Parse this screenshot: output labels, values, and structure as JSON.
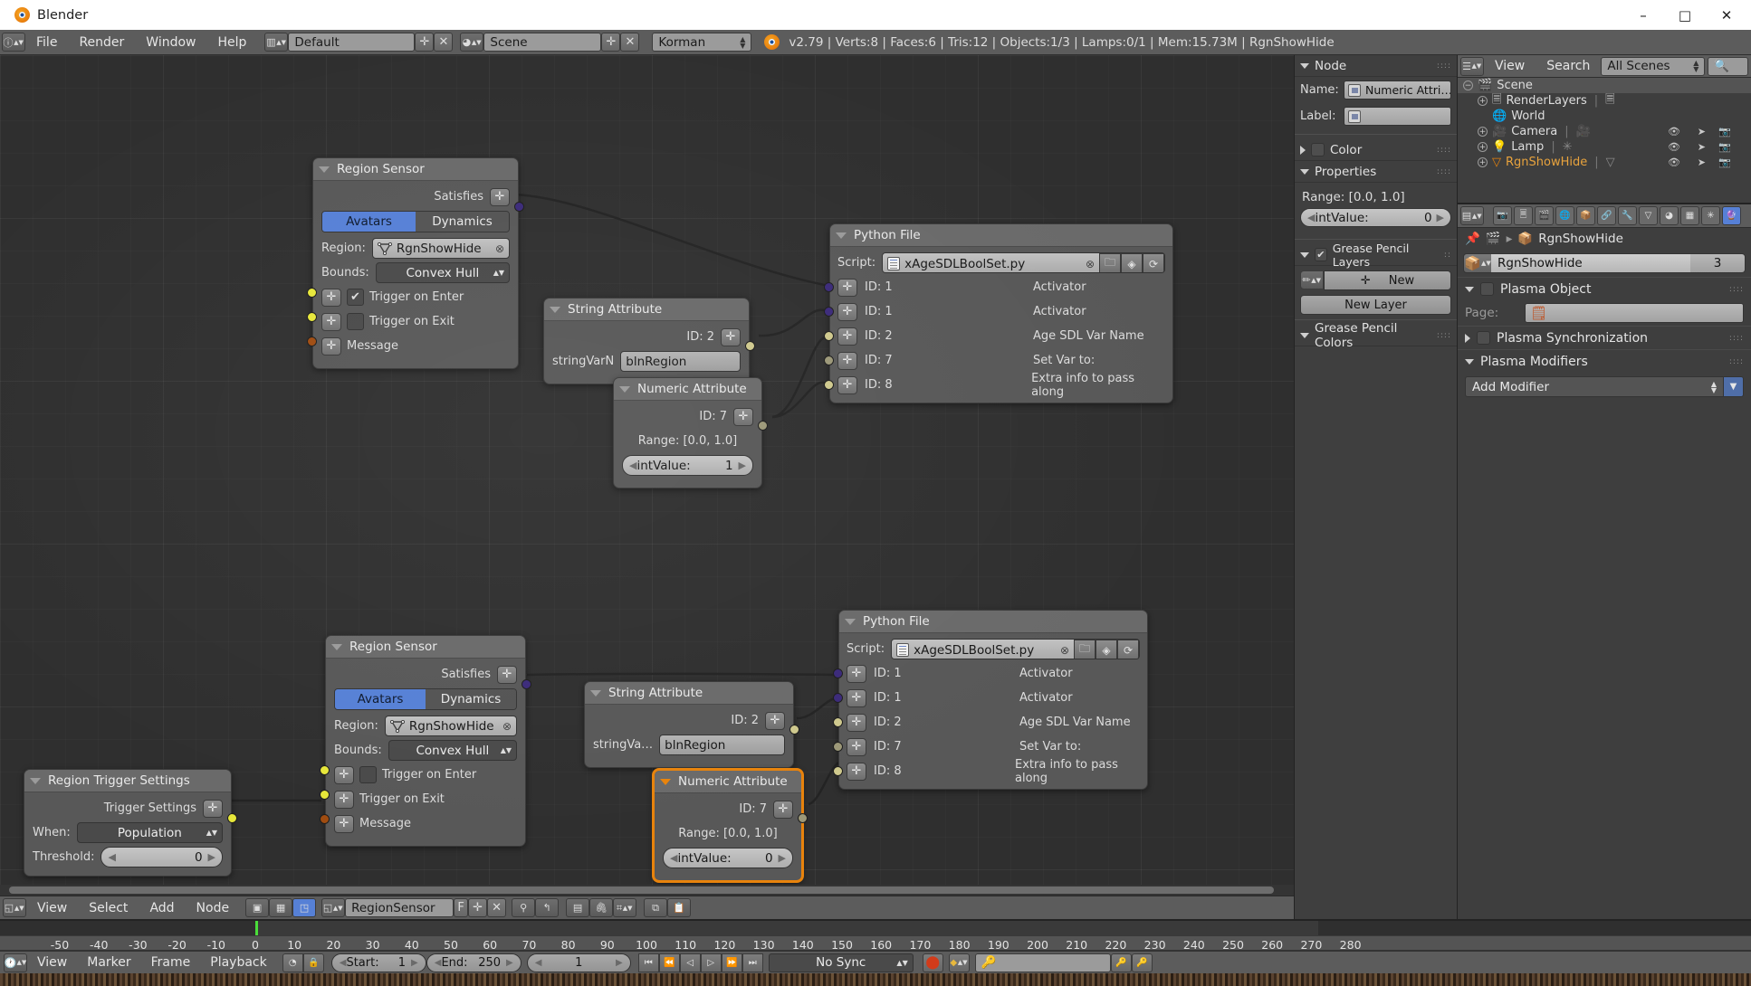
{
  "window": {
    "title": "Blender",
    "minimize": "–",
    "maximize": "□",
    "close": "✕"
  },
  "topbar": {
    "menus": [
      "File",
      "Render",
      "Window",
      "Help"
    ],
    "screen_layout": "Default",
    "scene": "Scene",
    "engine": "Korman",
    "status": "v2.79 | Verts:8 | Faces:6 | Tris:12 | Objects:1/3 | Lamps:0/1 | Mem:15.73M | RgnShowHide",
    "plus": "✛",
    "x": "✕"
  },
  "nodes": {
    "region_sensor_1": {
      "title": "Region Sensor",
      "output_label": "Satisfies",
      "toggle_on": "Avatars",
      "toggle_off": "Dynamics",
      "region_label": "Region:",
      "region_value": "RgnShowHide",
      "bounds_label": "Bounds:",
      "bounds_value": "Convex Hull",
      "trigger_enter": "Trigger on Enter",
      "trigger_exit": "Trigger on Exit",
      "message": "Message",
      "enter_checked": true,
      "exit_checked": false,
      "check_glyph": "✔"
    },
    "region_sensor_2": {
      "title": "Region Sensor",
      "output_label": "Satisfies",
      "toggle_on": "Avatars",
      "toggle_off": "Dynamics",
      "region_label": "Region:",
      "region_value": "RgnShowHide",
      "bounds_label": "Bounds:",
      "bounds_value": "Convex Hull",
      "trigger_enter": "Trigger on Enter",
      "trigger_exit": "Trigger on Exit",
      "message": "Message"
    },
    "string_attr_1": {
      "title": "String Attribute",
      "id_label": "ID: 2",
      "field_label": "stringVarN",
      "field_value": "blnRegion"
    },
    "string_attr_2": {
      "title": "String Attribute",
      "id_label": "ID: 2",
      "field_label": "stringVa…",
      "field_value": "blnRegion"
    },
    "numeric_attr_1": {
      "title": "Numeric Attribute",
      "id_label": "ID: 7",
      "range": "Range: [0.0, 1.0]",
      "value_label": "intValue:",
      "value": "1"
    },
    "numeric_attr_2": {
      "title": "Numeric Attribute",
      "id_label": "ID: 7",
      "range": "Range: [0.0, 1.0]",
      "value_label": "intValue:",
      "value": "0",
      "selected": true
    },
    "python_file_1": {
      "title": "Python File",
      "script_label": "Script:",
      "script_value": "xAgeSDLBoolSet.py",
      "params": [
        {
          "id": "ID: 1",
          "desc": "Activator",
          "sock": "purple"
        },
        {
          "id": "ID: 1",
          "desc": "Activator",
          "sock": "purple"
        },
        {
          "id": "ID: 2",
          "desc": "Age SDL Var Name",
          "sock": "khaki"
        },
        {
          "id": "ID: 7",
          "desc": "Set Var to:",
          "sock": "olive"
        },
        {
          "id": "ID: 8",
          "desc": "Extra info to pass along",
          "sock": "khaki"
        }
      ]
    },
    "python_file_2": {
      "title": "Python File",
      "script_label": "Script:",
      "script_value": "xAgeSDLBoolSet.py",
      "params": [
        {
          "id": "ID: 1",
          "desc": "Activator",
          "sock": "purple"
        },
        {
          "id": "ID: 1",
          "desc": "Activator",
          "sock": "purple"
        },
        {
          "id": "ID: 2",
          "desc": "Age SDL Var Name",
          "sock": "khaki"
        },
        {
          "id": "ID: 7",
          "desc": "Set Var to:",
          "sock": "olive"
        },
        {
          "id": "ID: 8",
          "desc": "Extra info to pass along",
          "sock": "khaki"
        }
      ]
    },
    "region_trigger_settings": {
      "title": "Region Trigger Settings",
      "output_label": "Trigger Settings",
      "when_label": "When:",
      "when_value": "Population",
      "threshold_label": "Threshold:",
      "threshold_value": "0"
    }
  },
  "node_footer": {
    "menus": [
      "View",
      "Select",
      "Add",
      "Node"
    ],
    "tree_name": "RegionSensor",
    "fake_user": "F",
    "plus": "✛",
    "x": "✕"
  },
  "node_properties": {
    "panel_node": "Node",
    "name_label": "Name:",
    "name_value": "Numeric Attri…",
    "label_label": "Label:",
    "label_value": "",
    "panel_color": "Color",
    "panel_properties": "Properties",
    "range": "Range: [0.0, 1.0]",
    "value_label": "intValue:",
    "value": "0",
    "panel_gp_layers": "Grease Pencil Layers",
    "new_button": "New",
    "new_layer_button": "New Layer",
    "panel_gp_colors": "Grease Pencil Colors"
  },
  "outliner": {
    "menus": [
      "View",
      "Search"
    ],
    "display_mode": "All Scenes",
    "search_placeholder": "",
    "rows": [
      {
        "label": "Scene",
        "indent": 0,
        "icon": "scene-icon",
        "selected": true,
        "has_eye": false
      },
      {
        "label": "RenderLayers",
        "indent": 1,
        "icon": "renderlayer-icon",
        "selected": false,
        "has_eye": false
      },
      {
        "label": "World",
        "indent": 1,
        "icon": "world-icon",
        "selected": false,
        "has_eye": false
      },
      {
        "label": "Camera",
        "indent": 1,
        "icon": "camera-icon",
        "selected": false,
        "has_eye": true
      },
      {
        "label": "Lamp",
        "indent": 1,
        "icon": "lamp-icon",
        "selected": false,
        "has_eye": true
      },
      {
        "label": "RgnShowHide",
        "indent": 1,
        "icon": "mesh-icon",
        "selected": false,
        "has_eye": true
      }
    ]
  },
  "properties_editor": {
    "breadcrumb_object": "RgnShowHide",
    "id_name": "RgnShowHide",
    "id_users": "3",
    "panel_plasma_object": "Plasma Object",
    "page_label": "Page:",
    "page_value": "",
    "panel_plasma_sync": "Plasma Synchronization",
    "panel_plasma_modifiers": "Plasma Modifiers",
    "add_modifier": "Add Modifier"
  },
  "timeline": {
    "menus": [
      "View",
      "Marker",
      "Frame",
      "Playback"
    ],
    "start_label": "Start:",
    "start_value": "1",
    "end_label": "End:",
    "end_value": "250",
    "current_frame": "1",
    "sync_mode": "No Sync",
    "ticks": [
      -50,
      -40,
      -30,
      -20,
      -10,
      0,
      10,
      20,
      30,
      40,
      50,
      60,
      70,
      80,
      90,
      100,
      110,
      120,
      130,
      140,
      150,
      160,
      170,
      180,
      190,
      200,
      210,
      220,
      230,
      240,
      250,
      260,
      270,
      280
    ],
    "playhead_frame": 1
  },
  "colors": {
    "accent_blue": "#5680d6",
    "select_orange": "#e8830c",
    "socket_purple": "#3b2a7a",
    "socket_yellow": "#e7e73a",
    "socket_khaki": "#cfc98d",
    "socket_brown": "#a04c10",
    "playhead_green": "#4ade3a"
  }
}
